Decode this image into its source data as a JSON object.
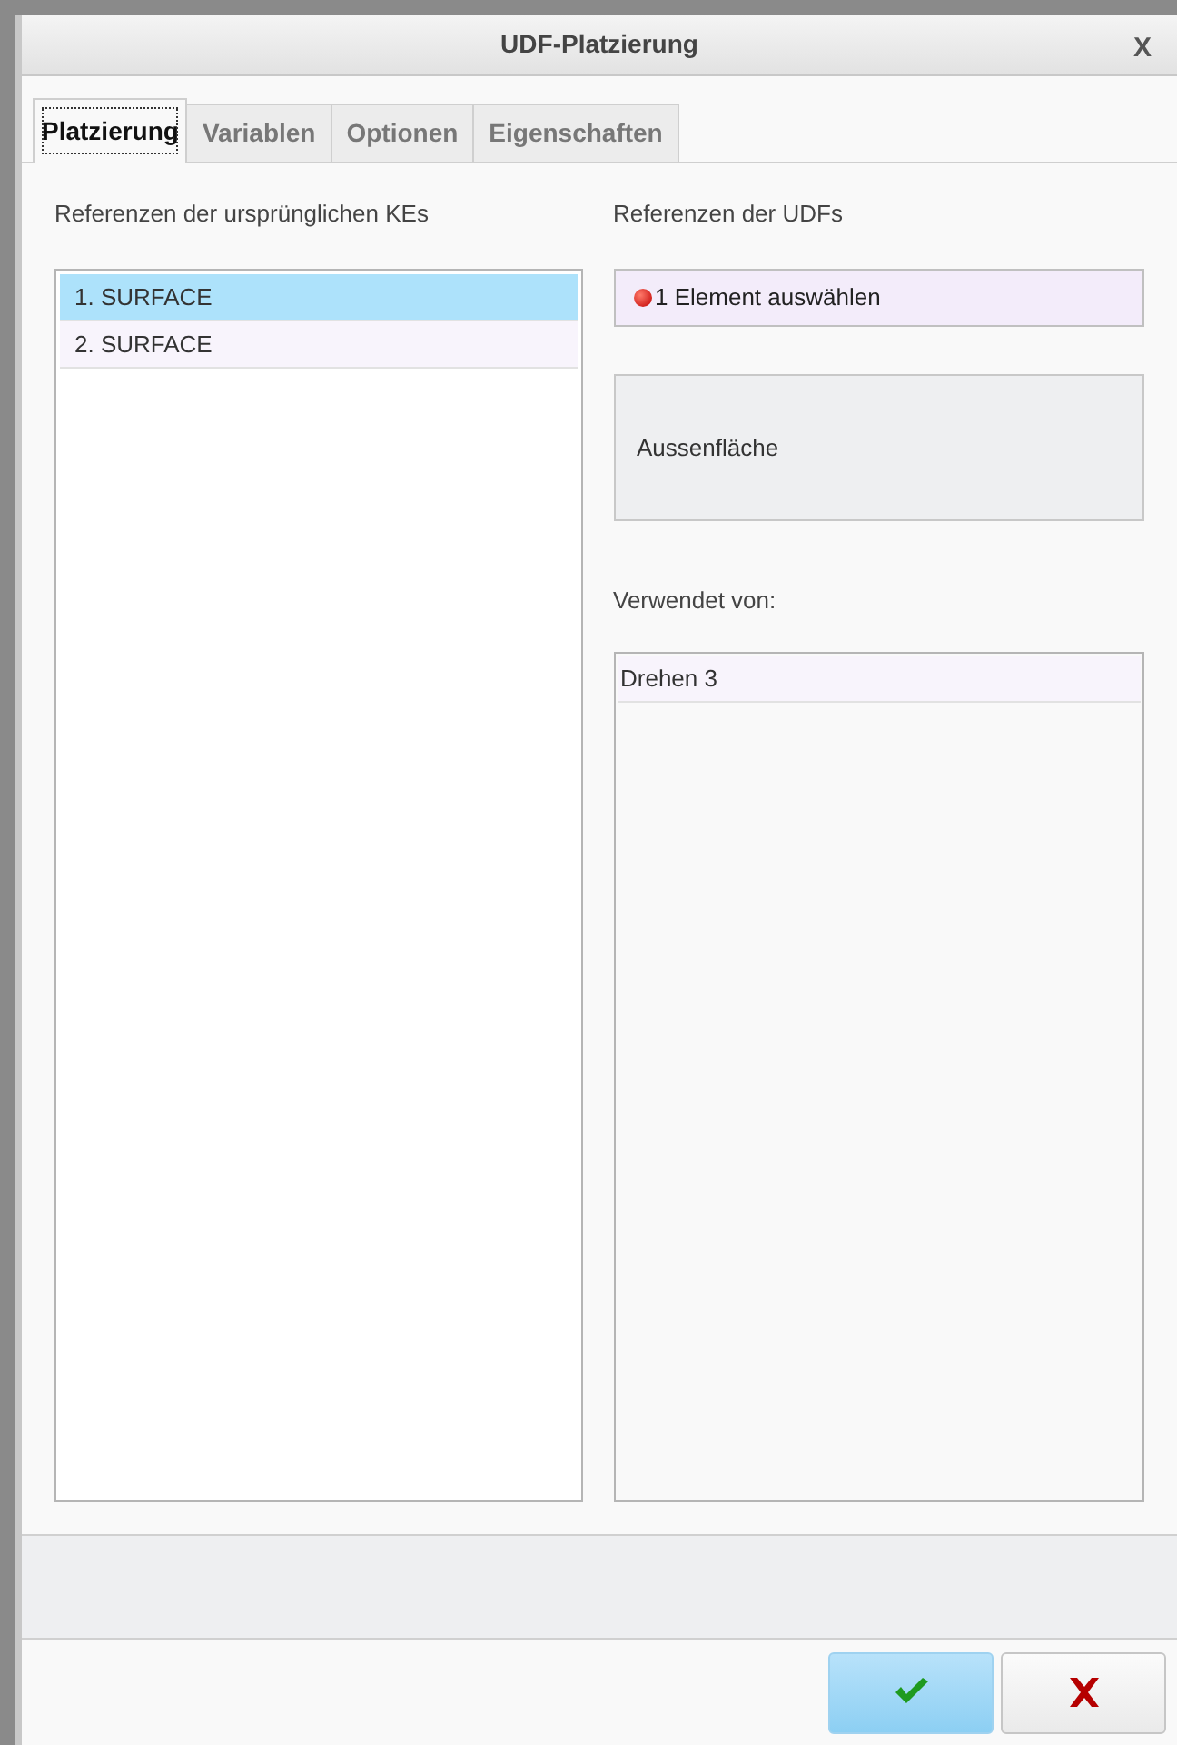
{
  "window": {
    "title": "UDF-Platzierung",
    "close": "X"
  },
  "tabs": [
    {
      "label": "Platzierung",
      "selected": true
    },
    {
      "label": "Variablen",
      "selected": false
    },
    {
      "label": "Optionen",
      "selected": false
    },
    {
      "label": "Eigenschaften",
      "selected": false
    }
  ],
  "original_references": {
    "label": "Referenzen der ursprünglichen KEs",
    "items": [
      {
        "label": "1. SURFACE",
        "selected": true
      },
      {
        "label": "2. SURFACE",
        "selected": false
      }
    ]
  },
  "udf_references": {
    "label": "Referenzen der UDFs",
    "collector": {
      "text": "1 Element auswählen",
      "required": true
    },
    "prompt": "Aussenfläche"
  },
  "used_by": {
    "label": "Verwendet von:",
    "items": [
      {
        "label": "Drehen 3"
      }
    ]
  },
  "buttons": [
    {
      "kind": "ok",
      "default": true
    },
    {
      "kind": "cancel",
      "default": false
    }
  ]
}
